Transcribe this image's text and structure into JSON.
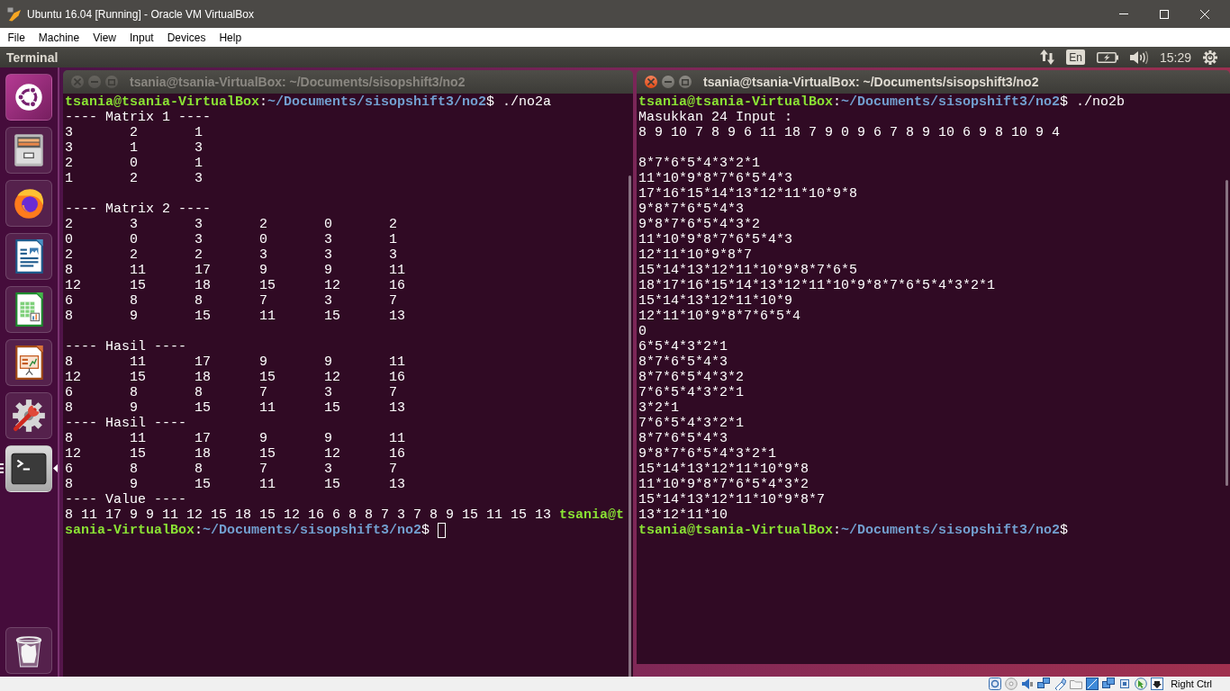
{
  "vm_window": {
    "title": "Ubuntu 16.04 [Running] - Oracle VM VirtualBox"
  },
  "menu_bar": [
    "File",
    "Machine",
    "View",
    "Input",
    "Devices",
    "Help"
  ],
  "top_panel": {
    "app_name": "Terminal",
    "keyboard_layout": "En",
    "clock": "15:29"
  },
  "launcher": {
    "items": [
      {
        "kind": "dash",
        "focused": false
      },
      {
        "kind": "files",
        "focused": false
      },
      {
        "kind": "browser",
        "focused": false
      },
      {
        "kind": "writer",
        "focused": false
      },
      {
        "kind": "calc",
        "focused": false
      },
      {
        "kind": "impress",
        "focused": false
      },
      {
        "kind": "settings",
        "focused": false
      },
      {
        "kind": "terminal",
        "focused": true
      }
    ],
    "bottom_items": [
      {
        "kind": "trash",
        "focused": false
      }
    ]
  },
  "terminals": [
    {
      "title": "tsania@tsania-VirtualBox: ~/Documents/sisopshift3/no2",
      "focused": false,
      "blocks": [
        [
          [
            {
              "kind": "user",
              "text": "tsania@tsania-VirtualBox"
            },
            {
              "kind": "text",
              "text": ":"
            },
            {
              "kind": "path",
              "text": "~/Documents/sisopshift3/no2"
            },
            {
              "kind": "text",
              "text": "$ ./no2a"
            }
          ],
          "---- Matrix 1 ----",
          "3\t2\t1",
          "3\t1\t3",
          "2\t0\t1",
          "1\t2\t3"
        ],
        [
          "---- Matrix 2 ----",
          "2\t3\t3\t2\t0\t2",
          "0\t0\t3\t0\t3\t1",
          "2\t2\t2\t3\t3\t3",
          "8\t11\t17\t9\t9\t11",
          "12\t15\t18\t15\t12\t16",
          "6\t8\t8\t7\t3\t7",
          "8\t9\t15\t11\t15\t13"
        ],
        [
          "---- Hasil ----",
          "8\t11\t17\t9\t9\t11",
          "12\t15\t18\t15\t12\t16",
          "6\t8\t8\t7\t3\t7",
          "8\t9\t15\t11\t15\t13",
          "---- Hasil ----",
          "8\t11\t17\t9\t9\t11",
          "12\t15\t18\t15\t12\t16",
          "6\t8\t8\t7\t3\t7",
          "8\t9\t15\t11\t15\t13",
          "---- Value ----",
          [
            {
              "kind": "text",
              "text": "8 11 17 9 9 11 12 15 18 15 12 16 6 8 8 7 3 7 8 9 15 11 15 13 "
            },
            {
              "kind": "user",
              "text": "tsania@t"
            }
          ],
          [
            {
              "kind": "user",
              "text": "sania-VirtualBox"
            },
            {
              "kind": "text",
              "text": ":"
            },
            {
              "kind": "path",
              "text": "~/Documents/sisopshift3/no2"
            },
            {
              "kind": "text",
              "text": "$ "
            },
            {
              "kind": "cursor"
            }
          ]
        ]
      ]
    },
    {
      "title": "tsania@tsania-VirtualBox: ~/Documents/sisopshift3/no2",
      "focused": true,
      "blocks": [
        [
          [
            {
              "kind": "user",
              "text": "tsania@tsania-VirtualBox"
            },
            {
              "kind": "text",
              "text": ":"
            },
            {
              "kind": "path",
              "text": "~/Documents/sisopshift3/no2"
            },
            {
              "kind": "text",
              "text": "$ ./no2b"
            }
          ],
          "Masukkan 24 Input :",
          "8 9 10 7 8 9 6 11 18 7 9 0 9 6 7 8 9 10 6 9 8 10 9 4"
        ],
        [
          "8*7*6*5*4*3*2*1",
          "11*10*9*8*7*6*5*4*3",
          "17*16*15*14*13*12*11*10*9*8",
          "9*8*7*6*5*4*3",
          "9*8*7*6*5*4*3*2",
          "11*10*9*8*7*6*5*4*3",
          "12*11*10*9*8*7",
          "15*14*13*12*11*10*9*8*7*6*5",
          "18*17*16*15*14*13*12*11*10*9*8*7*6*5*4*3*2*1",
          "15*14*13*12*11*10*9",
          "12*11*10*9*8*7*6*5*4",
          "0",
          "6*5*4*3*2*1",
          "8*7*6*5*4*3",
          "8*7*6*5*4*3*2",
          "7*6*5*4*3*2*1",
          "3*2*1",
          "7*6*5*4*3*2*1",
          "8*7*6*5*4*3",
          "9*8*7*6*5*4*3*2*1",
          "15*14*13*12*11*10*9*8",
          "11*10*9*8*7*6*5*4*3*2",
          "15*14*13*12*11*10*9*8*7",
          "13*12*11*10",
          [
            {
              "kind": "user",
              "text": "tsania@tsania-VirtualBox"
            },
            {
              "kind": "text",
              "text": ":"
            },
            {
              "kind": "path",
              "text": "~/Documents/sisopshift3/no2"
            },
            {
              "kind": "text",
              "text": "$"
            }
          ]
        ]
      ]
    }
  ],
  "status_bar": {
    "host_key": "Right Ctrl"
  }
}
